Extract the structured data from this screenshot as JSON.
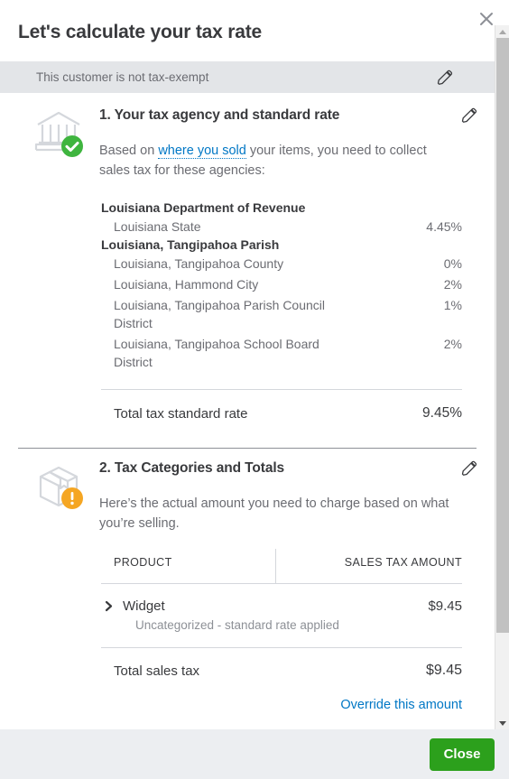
{
  "dialog": {
    "title": "Let's calculate your tax rate",
    "close_icon": "close-x-icon"
  },
  "exempt_banner": {
    "text": "This customer is not tax-exempt",
    "edit_icon": "pencil-icon"
  },
  "section1": {
    "icon": "bank-icon",
    "status_badge": "check-circle-icon",
    "title": "1. Your tax agency and standard rate",
    "edit_icon": "pencil-icon",
    "desc_before": "Based on ",
    "desc_link": "where you sold",
    "desc_after": " your items, you need to collect sales tax for these agencies:",
    "groups": [
      {
        "name": "Louisiana Department of Revenue",
        "rows": [
          {
            "name": "Louisiana State",
            "rate": "4.45%"
          }
        ]
      },
      {
        "name": "Louisiana, Tangipahoa Parish",
        "rows": [
          {
            "name": "Louisiana, Tangipahoa County",
            "rate": "0%"
          },
          {
            "name": "Louisiana, Hammond City",
            "rate": "2%"
          },
          {
            "name": "Louisiana, Tangipahoa Parish Council District",
            "rate": "1%"
          },
          {
            "name": "Louisiana, Tangipahoa School Board District",
            "rate": "2%"
          }
        ]
      }
    ],
    "total_label": "Total tax standard rate",
    "total_value": "9.45%"
  },
  "section2": {
    "icon": "package-box-icon",
    "status_badge": "warning-circle-icon",
    "title": "2. Tax Categories and Totals",
    "edit_icon": "pencil-icon",
    "desc": "Here’s the actual amount you need to charge based on what you’re selling.",
    "table": {
      "columns": [
        "PRODUCT",
        "SALES TAX AMOUNT"
      ],
      "rows": [
        {
          "expander_icon": "chevron-right-icon",
          "product": "Widget",
          "subtitle": "Uncategorized - standard rate applied",
          "amount": "$9.45"
        }
      ]
    },
    "total_label": "Total sales tax",
    "total_value": "$9.45",
    "override_link": "Override this amount"
  },
  "footer": {
    "close_label": "Close"
  },
  "colors": {
    "accent_green": "#2ca01c",
    "link_blue": "#0077c5",
    "warning_orange": "#f5a623",
    "banner_gray": "#e3e5e8",
    "footer_gray": "#eceef1",
    "text_dark": "#393a3d",
    "text_muted": "#6b6c72"
  }
}
